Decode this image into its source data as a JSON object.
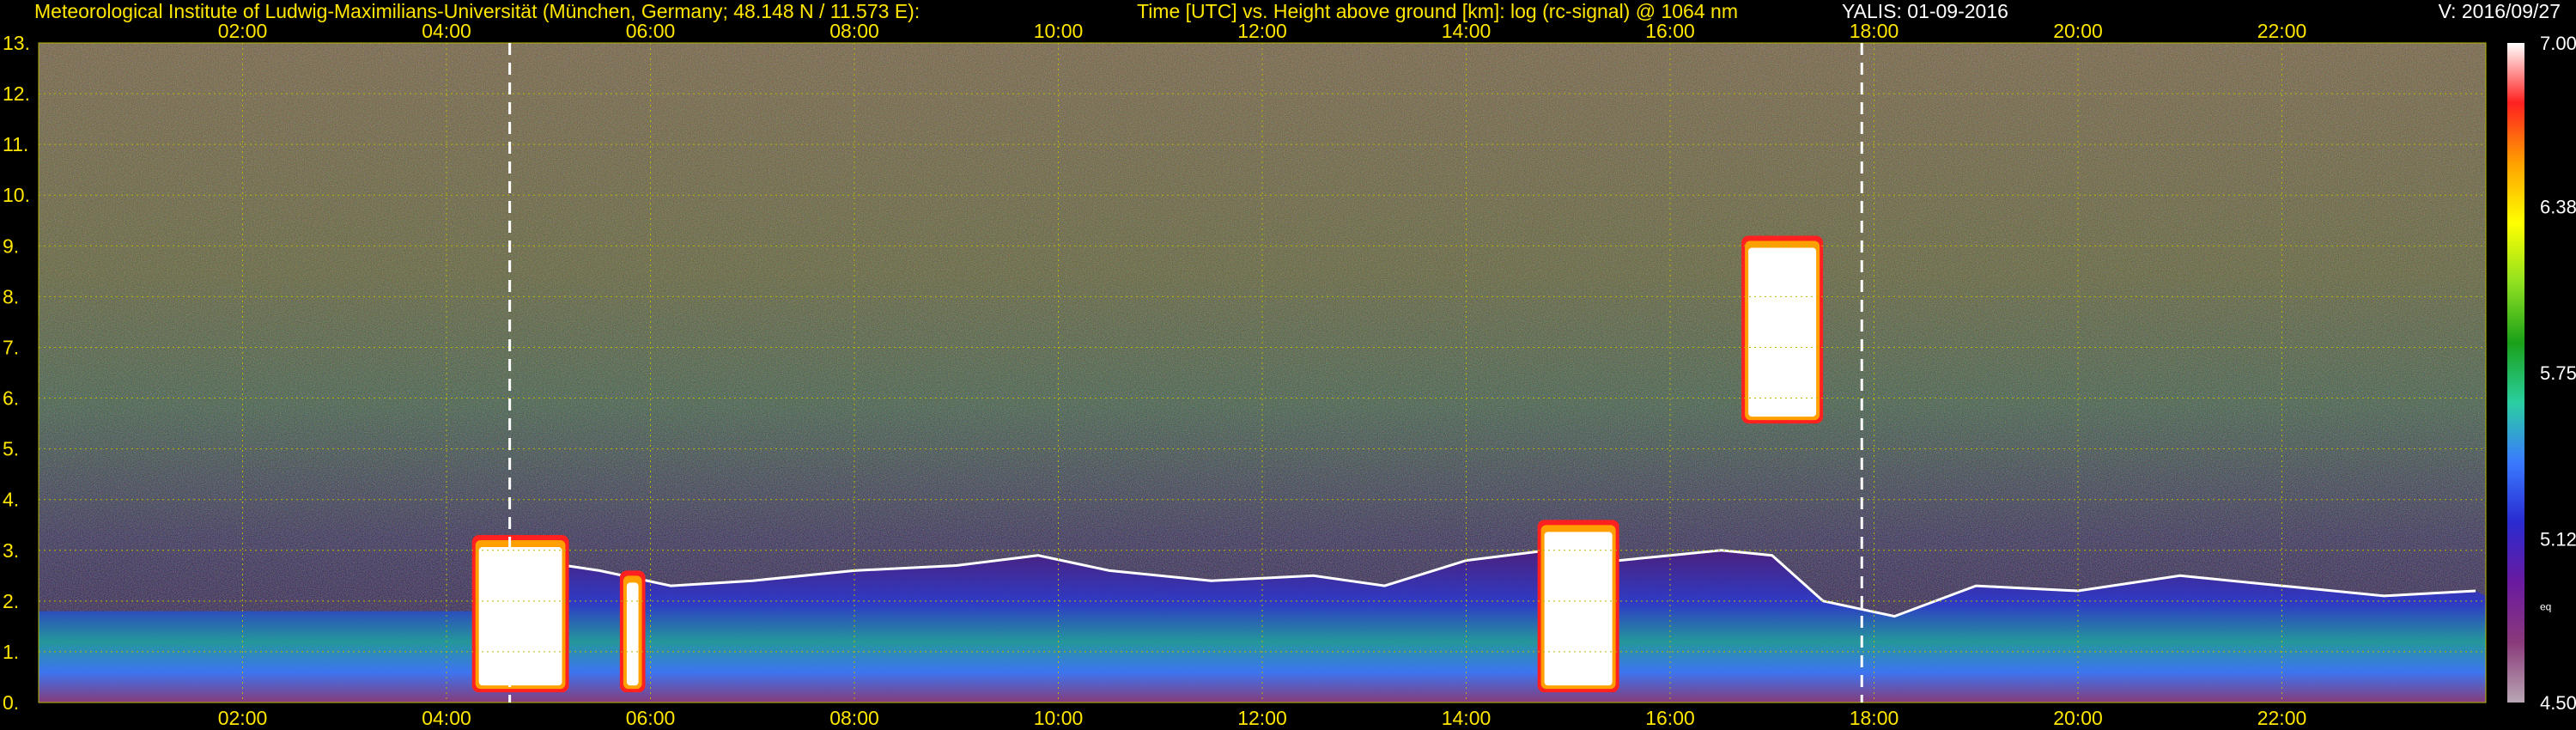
{
  "header": {
    "left": "Meteorological Institute of Ludwig-Maximilians-Universität (München, Germany; 48.148 N / 11.573 E):",
    "middle": "Time [UTC] vs. Height above ground [km]: log (rc-signal) @ 1064 nm",
    "date": "YALIS: 01-09-2016",
    "version": "V: 2016/09/27"
  },
  "chart_data": {
    "type": "heatmap",
    "x_ticks": [
      "02:00",
      "04:00",
      "06:00",
      "08:00",
      "10:00",
      "12:00",
      "14:00",
      "16:00",
      "18:00",
      "20:00",
      "22:00"
    ],
    "x_tick_hours": [
      2,
      4,
      6,
      8,
      10,
      12,
      14,
      16,
      18,
      20,
      22
    ],
    "xlim_hours": [
      0,
      24
    ],
    "y_ticks": [
      "0.",
      "1.",
      "2.",
      "3.",
      "4.",
      "5.",
      "6.",
      "7.",
      "8.",
      "9.",
      "10.",
      "11.",
      "12.",
      "13."
    ],
    "ylim_km": [
      0,
      13
    ],
    "grid": true,
    "colorbar": {
      "ticks": [
        "7.00",
        "6.38",
        "5.75",
        "5.12",
        "4.50"
      ],
      "tick_values": [
        7.0,
        6.38,
        5.75,
        5.12,
        4.5
      ],
      "range": [
        4.5,
        7.0
      ],
      "small_label": "eq",
      "colors": [
        "#b9a7b4",
        "#8a3a7a",
        "#6a1aa0",
        "#2a2ad0",
        "#3a7aff",
        "#2acfa0",
        "#1aa01a",
        "#8fe020",
        "#ffff00",
        "#ffa000",
        "#ff2020",
        "#ffffff"
      ]
    },
    "dashed_markers_hours": [
      4.62,
      17.88
    ],
    "boundary_layer_top_km": {
      "hours": [
        4.5,
        5.5,
        6.2,
        7.0,
        8.0,
        9.0,
        9.8,
        10.5,
        11.5,
        12.5,
        13.2,
        14.0,
        14.8,
        15.5,
        16.0,
        16.5,
        17.0,
        17.5,
        18.2,
        19.0,
        20.0,
        21.0,
        22.0,
        23.0,
        23.9
      ],
      "km": [
        2.9,
        2.6,
        2.3,
        2.4,
        2.6,
        2.7,
        2.9,
        2.6,
        2.4,
        2.5,
        2.3,
        2.8,
        3.0,
        2.8,
        2.9,
        3.0,
        2.9,
        2.0,
        1.7,
        2.3,
        2.2,
        2.5,
        2.3,
        2.1,
        2.2
      ]
    },
    "clouds": [
      {
        "start_hour": 4.25,
        "end_hour": 5.2,
        "base_km": 0.2,
        "top_km": 3.3,
        "signal": "high"
      },
      {
        "start_hour": 5.7,
        "end_hour": 5.95,
        "base_km": 0.2,
        "top_km": 2.6,
        "signal": "high"
      },
      {
        "start_hour": 14.7,
        "end_hour": 15.5,
        "base_km": 0.2,
        "top_km": 3.6,
        "signal": "high"
      },
      {
        "start_hour": 16.7,
        "end_hour": 17.5,
        "base_km": 5.5,
        "top_km": 9.2,
        "signal": "high"
      }
    ]
  }
}
